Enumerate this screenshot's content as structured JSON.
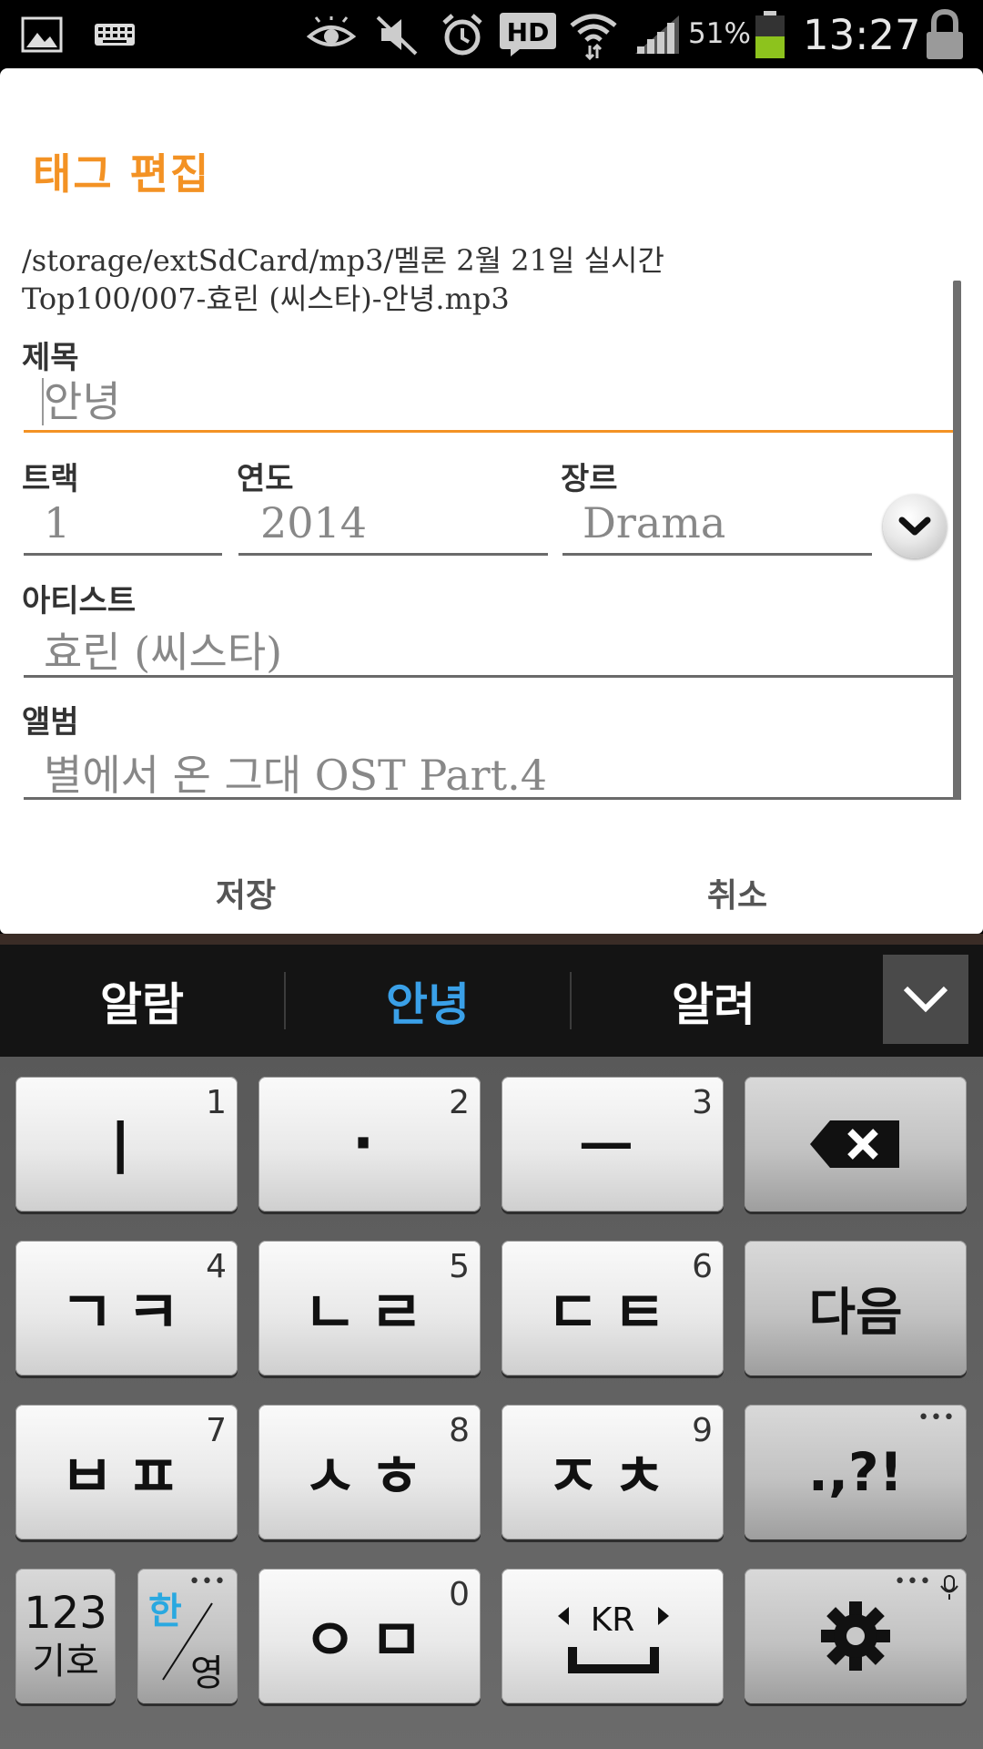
{
  "status_bar": {
    "icons": [
      "gallery-icon",
      "keyboard-icon",
      "eye-icon",
      "mute-icon",
      "alarm-icon",
      "hd-icon",
      "wifi-icon",
      "signal-icon",
      "battery-icon",
      "lock-icon"
    ],
    "battery_percent": "51%",
    "time": "13:27"
  },
  "dialog": {
    "title": "태그 편집",
    "file_path": "/storage/extSdCard/mp3/멜론 2월 21일 실시간 Top100/007-효린 (씨스타)-안녕.mp3",
    "fields": {
      "title": {
        "label": "제목",
        "value": "안녕"
      },
      "track": {
        "label": "트랙",
        "value": "1"
      },
      "year": {
        "label": "연도",
        "value": "2014"
      },
      "genre": {
        "label": "장르",
        "value": "Drama"
      },
      "artist": {
        "label": "아티스트",
        "value": "효린 (씨스타)"
      },
      "album": {
        "label": "앨범",
        "value": "별에서 온 그대 OST Part.4"
      }
    },
    "buttons": {
      "save": "저장",
      "cancel": "취소"
    }
  },
  "candidates": [
    "알람",
    "안녕",
    "알려"
  ],
  "candidate_selected_color": "#3aa0e8",
  "keyboard": {
    "rows": [
      [
        {
          "main": "ㅣ",
          "num": "1"
        },
        {
          "main": "·",
          "num": "2"
        },
        {
          "main": "ㅡ",
          "num": "3"
        },
        {
          "main": "backspace-icon",
          "num": ""
        }
      ],
      [
        {
          "main": "ㄱㅋ",
          "num": "4"
        },
        {
          "main": "ㄴㄹ",
          "num": "5"
        },
        {
          "main": "ㄷㅌ",
          "num": "6"
        },
        {
          "main": "다음",
          "num": ""
        }
      ],
      [
        {
          "main": "ㅂㅍ",
          "num": "7"
        },
        {
          "main": "ㅅㅎ",
          "num": "8"
        },
        {
          "main": "ㅈㅊ",
          "num": "9"
        },
        {
          "main": ".,?!",
          "num": ""
        }
      ],
      [
        {
          "main": "123",
          "sub": "기호"
        },
        {
          "main": "한",
          "sub": "영"
        },
        {
          "main": "ㅇㅁ",
          "num": "0"
        },
        {
          "main": "KR"
        },
        {
          "main": "gear-icon"
        }
      ]
    ],
    "more_dots": "•••",
    "lang_highlight_color": "#29a8e0"
  }
}
